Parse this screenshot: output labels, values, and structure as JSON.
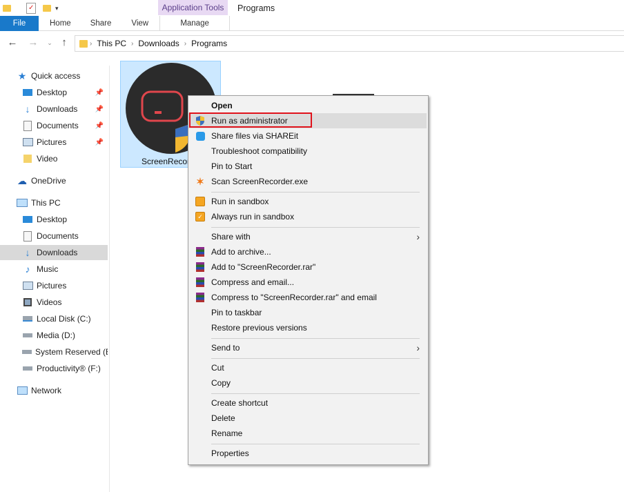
{
  "ribbon": {
    "contextual_tab": "Application Tools",
    "window_title": "Programs",
    "tabs": [
      "File",
      "Home",
      "Share",
      "View",
      "Manage"
    ]
  },
  "address": {
    "crumbs": [
      "This PC",
      "Downloads",
      "Programs"
    ]
  },
  "sidebar": {
    "items": [
      {
        "label": "Quick access"
      },
      {
        "label": "Desktop"
      },
      {
        "label": "Downloads"
      },
      {
        "label": "Documents"
      },
      {
        "label": "Pictures"
      },
      {
        "label": "Video"
      },
      {
        "label": "OneDrive"
      },
      {
        "label": "This PC"
      },
      {
        "label": "Desktop"
      },
      {
        "label": "Documents"
      },
      {
        "label": "Downloads"
      },
      {
        "label": "Music"
      },
      {
        "label": "Pictures"
      },
      {
        "label": "Videos"
      },
      {
        "label": "Local Disk (C:)"
      },
      {
        "label": "Media (D:)"
      },
      {
        "label": "System Reserved (E:"
      },
      {
        "label": "Productivity® (F:)"
      },
      {
        "label": "Network"
      }
    ]
  },
  "file": {
    "name": "ScreenRecor"
  },
  "context_menu": {
    "items": [
      {
        "label": "Open"
      },
      {
        "label": "Run as administrator"
      },
      {
        "label": "Share files via SHAREit"
      },
      {
        "label": "Troubleshoot compatibility"
      },
      {
        "label": "Pin to Start"
      },
      {
        "label": "Scan ScreenRecorder.exe"
      },
      {
        "label": "Run in sandbox"
      },
      {
        "label": "Always run in sandbox"
      },
      {
        "label": "Share with"
      },
      {
        "label": "Add to archive..."
      },
      {
        "label": "Add to \"ScreenRecorder.rar\""
      },
      {
        "label": "Compress and email..."
      },
      {
        "label": "Compress to \"ScreenRecorder.rar\" and email"
      },
      {
        "label": "Pin to taskbar"
      },
      {
        "label": "Restore previous versions"
      },
      {
        "label": "Send to"
      },
      {
        "label": "Cut"
      },
      {
        "label": "Copy"
      },
      {
        "label": "Create shortcut"
      },
      {
        "label": "Delete"
      },
      {
        "label": "Rename"
      },
      {
        "label": "Properties"
      }
    ]
  },
  "colors": {
    "file_tab": "#1979ca",
    "selection": "#cce8ff",
    "highlight": "#e0121b",
    "contextual_tab_bg": "#e8d9f3"
  }
}
